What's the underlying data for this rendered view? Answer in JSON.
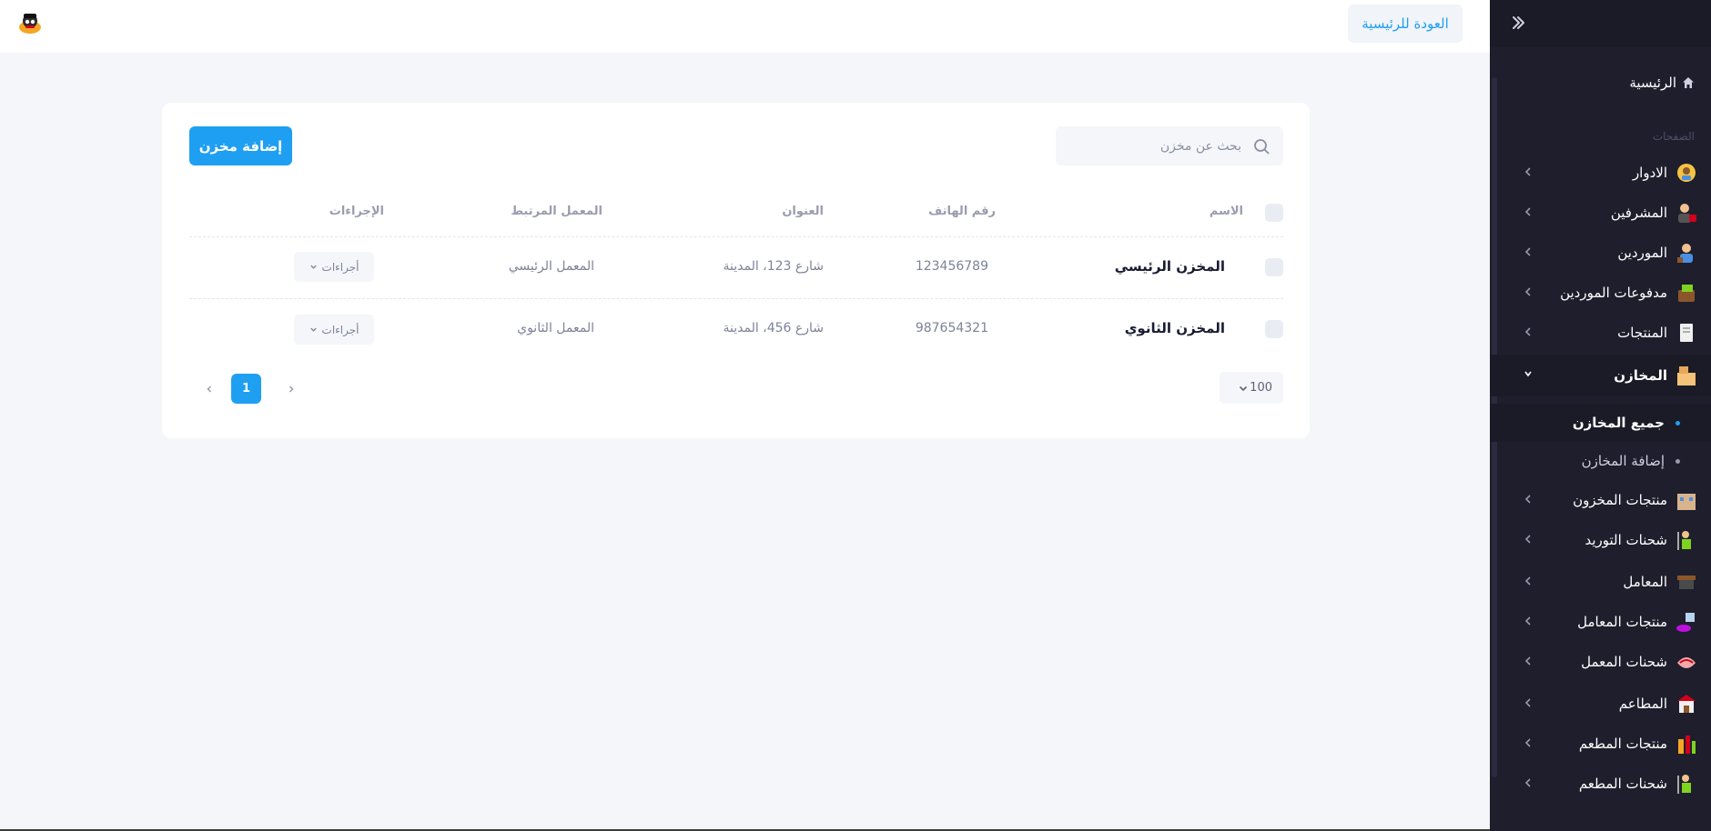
{
  "header": {
    "back_home_label": "العودة للرئيسية"
  },
  "sidebar": {
    "home_label": "الرئيسية",
    "section_label": "الصفحات",
    "items": [
      {
        "label": "الادوار",
        "icon": "roles-icon"
      },
      {
        "label": "المشرفين",
        "icon": "supervisors-icon"
      },
      {
        "label": "الموردين",
        "icon": "suppliers-icon"
      },
      {
        "label": "مدفوعات الموردين",
        "icon": "supplier-payments-icon"
      },
      {
        "label": "المنتجات",
        "icon": "products-icon"
      },
      {
        "label": "المخازن",
        "icon": "warehouses-icon"
      },
      {
        "label": "منتجات المخزون",
        "icon": "stock-products-icon"
      },
      {
        "label": "شحنات التوريد",
        "icon": "supply-shipments-icon"
      },
      {
        "label": "المعامل",
        "icon": "factories-icon"
      },
      {
        "label": "منتجات المعامل",
        "icon": "factory-products-icon"
      },
      {
        "label": "شحنات المعمل",
        "icon": "factory-shipments-icon"
      },
      {
        "label": "المطاعم",
        "icon": "restaurants-icon"
      },
      {
        "label": "منتجات المطعم",
        "icon": "restaurant-products-icon"
      },
      {
        "label": "شحنات المطعم",
        "icon": "restaurant-shipments-icon"
      }
    ],
    "sub_items": [
      {
        "label": "جميع المخازن"
      },
      {
        "label": "إضافة المخازن"
      }
    ]
  },
  "toolbar": {
    "search_placeholder": "بحث عن مخزن",
    "add_label": "إضافة مخزن"
  },
  "table": {
    "headers": {
      "name": "الاسم",
      "phone": "رقم الهاتف",
      "address": "العنوان",
      "lab": "المعمل المرتبط",
      "actions": "الإجراءات"
    },
    "rows": [
      {
        "name": "المخزن الرئيسي",
        "phone": "123456789",
        "address": "شارع 123، المدينة",
        "lab": "المعمل الرئيسي",
        "action_label": "أجراءات"
      },
      {
        "name": "المخزن الثانوي",
        "phone": "987654321",
        "address": "شارع 456، المدينة",
        "lab": "المعمل الثانوي",
        "action_label": "أجراءات"
      }
    ]
  },
  "pagination": {
    "page_size": "100",
    "current_page": "1"
  },
  "colors": {
    "accent": "#1e9ff2",
    "sidebar_bg": "#1e1e2d"
  }
}
